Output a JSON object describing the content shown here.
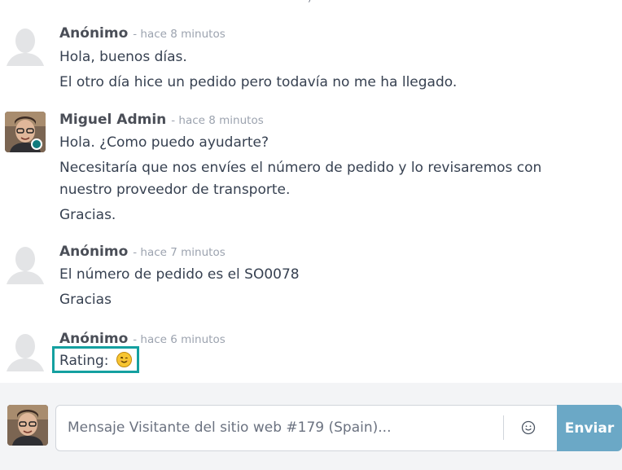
{
  "thread": {
    "messages": [
      {
        "author": "Anónimo",
        "time": "- hace 8 minutos",
        "lines": [
          "Hola, buenos días.",
          "El otro día hice un pedido pero todavía no me ha llegado."
        ]
      },
      {
        "author": "Miguel Admin",
        "time": "- hace 8 minutos",
        "lines": [
          "Hola. ¿Como puedo ayudarte?",
          "Necesitaría que nos envíes el número de pedido y lo revisaremos con",
          "nuestro proveedor de transporte.",
          "Gracias."
        ]
      },
      {
        "author": "Anónimo",
        "time": "- hace 7 minutos",
        "lines": [
          "El número de pedido es el SO0078",
          "Gracias"
        ]
      },
      {
        "author": "Anónimo",
        "time": "- hace 6 minutos",
        "rating_label": "Rating:",
        "rating_icon": "smiling-face-icon"
      }
    ]
  },
  "composer": {
    "placeholder": "Mensaje Visitante del sitio web #179 (Spain)...",
    "emoji_icon": "emoji-smiley-icon",
    "send_label": "Enviar"
  },
  "colors": {
    "accent": "#14a0a0",
    "send_button": "#6ba8c6",
    "status_online": "#0f7b7d"
  }
}
